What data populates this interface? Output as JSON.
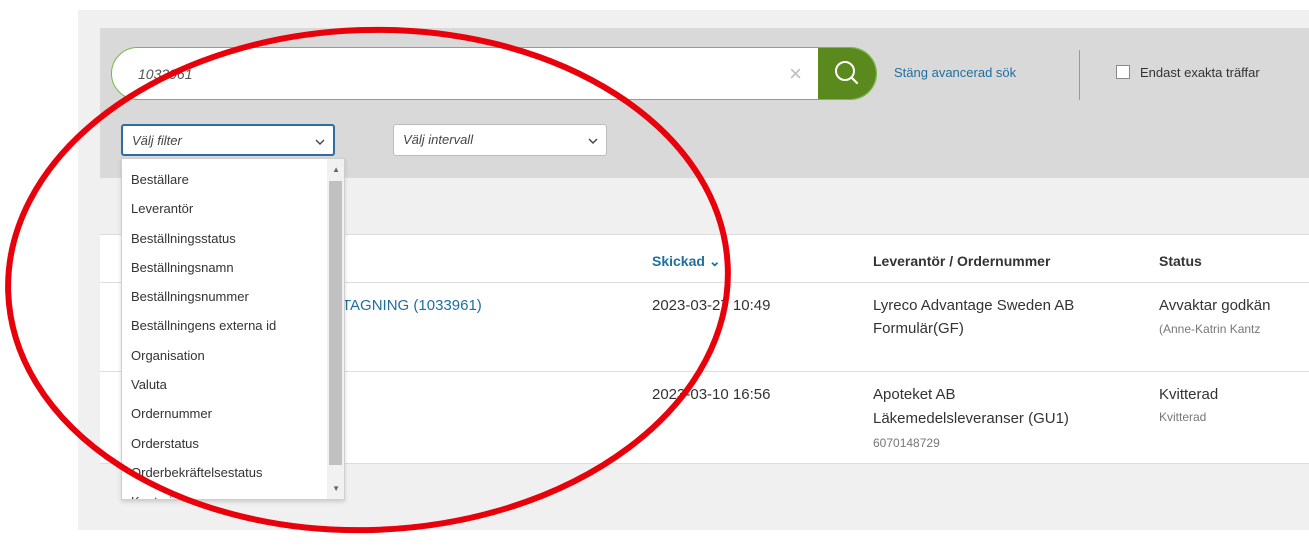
{
  "search": {
    "value": "1033961",
    "clear_icon": "×",
    "advanced_link": "Stäng avancerad sök",
    "exact_label": "Endast exakta träffar"
  },
  "filters": {
    "filter_placeholder": "Välj filter",
    "interval_placeholder": "Välj intervall",
    "chevron": "⌄"
  },
  "dropdown": {
    "options": [
      "Beställare",
      "Leverantör",
      "Beställningsstatus",
      "Beställningsnamn",
      "Beställningsnummer",
      "Beställningens externa id",
      "Organisation",
      "Valuta",
      "Ordernummer",
      "Orderstatus",
      "Orderbekräftelsestatus",
      "Kontering"
    ]
  },
  "table": {
    "headers": {
      "sent": "Skickad ⌄",
      "supplier": "Leverantör / Ordernummer",
      "status": "Status"
    },
    "rows": [
      {
        "name": "TAGNING (1033961)",
        "sent": "2023-03-27 10:49",
        "supplier": "Lyreco Advantage Sweden AB",
        "supplier_sub": "Formulär(GF)",
        "order_no": "",
        "status": "Avvaktar godkän",
        "status_sub": "(Anne-Katrin Kantz"
      },
      {
        "name": "",
        "sent": "2023-03-10 16:56",
        "supplier": "Apoteket AB",
        "supplier_sub": "Läkemedelsleveranser (GU1)",
        "order_no": "6070148729",
        "status": "Kvitterad",
        "status_sub": "Kvitterad"
      }
    ]
  },
  "colors": {
    "search_button": "#5a8a1e",
    "link": "#1f6f9f",
    "annotation": "#e8000b"
  },
  "icons": {
    "search": "magnifier-icon",
    "clear": "close-icon",
    "chevron": "chevron-down-icon"
  }
}
